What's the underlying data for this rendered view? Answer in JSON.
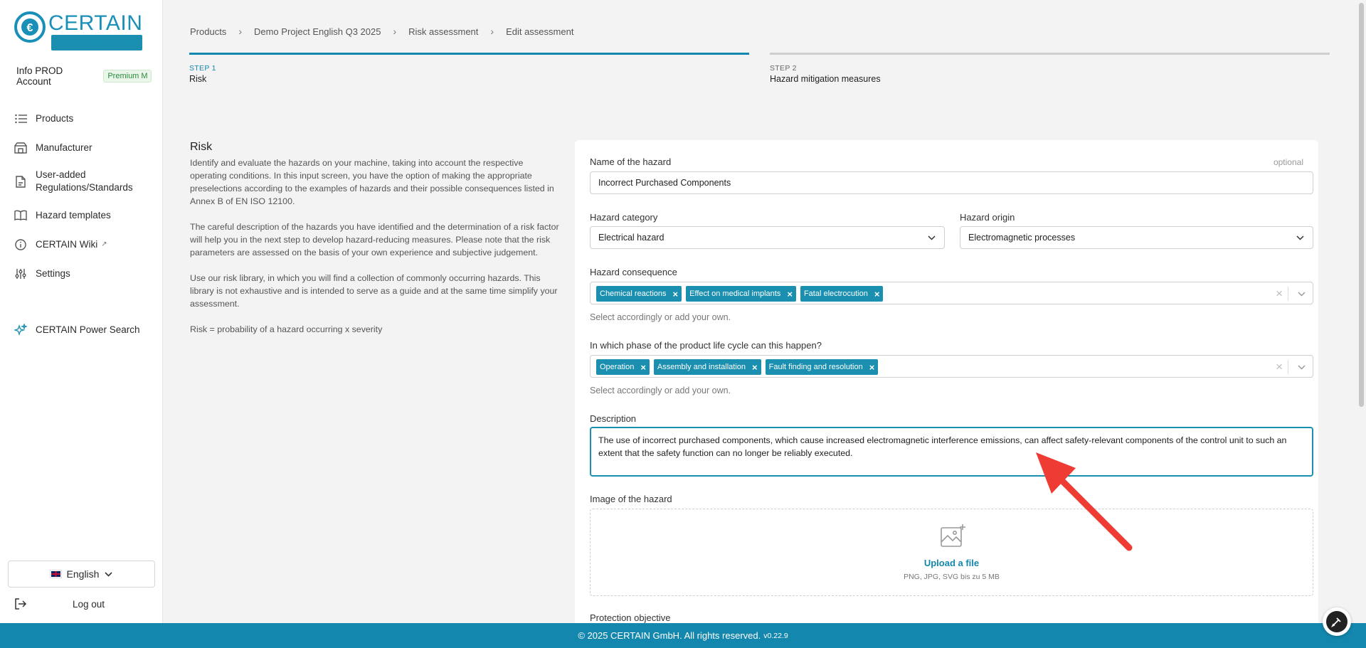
{
  "brand": {
    "name": "CERTAIN",
    "tagline": "your CE marking... online"
  },
  "account": {
    "name": "Info PROD Account",
    "plan": "Premium M"
  },
  "sidebar": {
    "items": [
      {
        "label": "Products",
        "icon": "list-icon"
      },
      {
        "label": "Manufacturer",
        "icon": "factory-icon"
      },
      {
        "label": "User-added Regulations/Standards",
        "icon": "document-icon"
      },
      {
        "label": "Hazard templates",
        "icon": "book-icon"
      },
      {
        "label": "CERTAIN Wiki",
        "icon": "info-icon"
      },
      {
        "label": "Settings",
        "icon": "sliders-icon"
      }
    ],
    "power_search": "CERTAIN Power Search",
    "language": "English",
    "logout": "Log out"
  },
  "breadcrumb": [
    "Products",
    "Demo Project English Q3 2025",
    "Risk assessment",
    "Edit assessment"
  ],
  "steps": [
    {
      "number": "STEP 1",
      "name": "Risk"
    },
    {
      "number": "STEP 2",
      "name": "Hazard mitigation measures"
    }
  ],
  "intro": {
    "title": "Risk",
    "p1": "Identify and evaluate the hazards on your machine, taking into account the respective operating conditions. In this input screen, you have the option of making the appropriate preselections according to the examples of hazards and their possible consequences listed in Annex B of EN ISO 12100.",
    "p2": "The careful description of the hazards you have identified and the determination of a risk factor will help you in the next step to develop hazard-reducing measures. Please note that the risk parameters are assessed on the basis of your own experience and subjective judgement.",
    "p3": "Use our risk library, in which you will find a collection of commonly occurring hazards. This library is not exhaustive and is intended to serve as a guide and at the same time simplify your assessment.",
    "p4": "Risk = probability of a hazard occurring x severity"
  },
  "form": {
    "hazard_name": {
      "label": "Name of the hazard",
      "optional": "optional",
      "value": "Incorrect Purchased Components"
    },
    "hazard_category": {
      "label": "Hazard category",
      "value": "Electrical hazard"
    },
    "hazard_origin": {
      "label": "Hazard origin",
      "value": "Electromagnetic processes"
    },
    "hazard_consequence": {
      "label": "Hazard consequence",
      "tags": [
        "Chemical reactions",
        "Effect on medical implants",
        "Fatal electrocution"
      ],
      "hint": "Select accordingly or add your own."
    },
    "life_cycle": {
      "label": "In which phase of the product life cycle can this happen?",
      "tags": [
        "Operation",
        "Assembly and installation",
        "Fault finding and resolution"
      ],
      "hint": "Select accordingly or add your own."
    },
    "description": {
      "label": "Description",
      "value": "The use of incorrect purchased components, which cause increased electromagnetic interference emissions, can affect safety-relevant components of the control unit to such an extent that the safety function can no longer be reliably executed."
    },
    "image": {
      "label": "Image of the hazard",
      "upload": "Upload a file",
      "hint": "PNG, JPG, SVG bis zu 5 MB"
    },
    "protection_objective": {
      "label": "Protection objective"
    }
  },
  "footer": {
    "text": "© 2025 CERTAIN GmbH. All rights reserved.",
    "version": "v0.22.9"
  },
  "colors": {
    "accent": "#1387ad",
    "tag": "#1a8fb0",
    "annotation_arrow": "#ee3b34"
  }
}
